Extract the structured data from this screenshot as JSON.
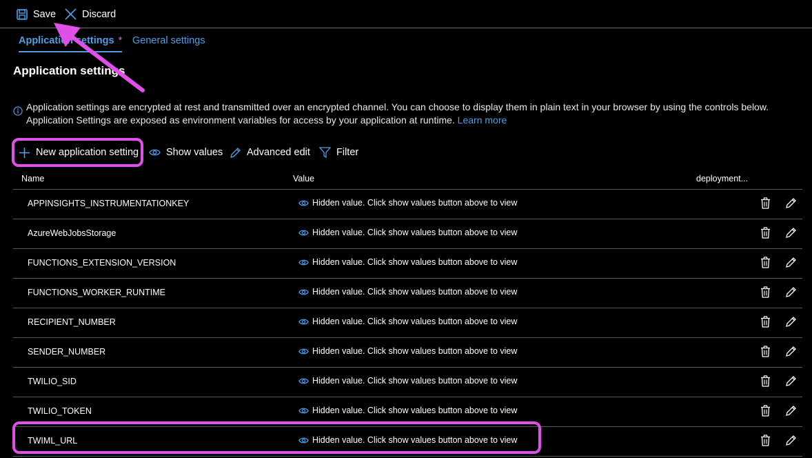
{
  "toolbar": {
    "save_label": "Save",
    "discard_label": "Discard"
  },
  "tabs": [
    {
      "label": "Application settings",
      "modified_marker": "*",
      "active": true
    },
    {
      "label": "General settings",
      "active": false
    }
  ],
  "section": {
    "title": "Application settings",
    "info_text": "Application settings are encrypted at rest and transmitted over an encrypted channel. You can choose to display them in plain text in your browser by using the controls below. Application Settings are exposed as environment variables for access by your application at runtime.",
    "info_link": "Learn more"
  },
  "actions": {
    "new_setting": "New application setting",
    "show_values": "Show values",
    "advanced_edit": "Advanced edit",
    "filter": "Filter"
  },
  "table": {
    "columns": [
      "Name",
      "Value",
      "deployment..."
    ],
    "rows": [
      {
        "name": "APPINSIGHTS_INSTRUMENTATIONKEY",
        "value": "Hidden value. Click show values button above to view"
      },
      {
        "name": "AzureWebJobsStorage",
        "value": "Hidden value. Click show values button above to view"
      },
      {
        "name": "FUNCTIONS_EXTENSION_VERSION",
        "value": "Hidden value. Click show values button above to view"
      },
      {
        "name": "FUNCTIONS_WORKER_RUNTIME",
        "value": "Hidden value. Click show values button above to view"
      },
      {
        "name": "RECIPIENT_NUMBER",
        "value": "Hidden value. Click show values button above to view"
      },
      {
        "name": "SENDER_NUMBER",
        "value": "Hidden value. Click show values button above to view"
      },
      {
        "name": "TWILIO_SID",
        "value": "Hidden value. Click show values button above to view"
      },
      {
        "name": "TWILIO_TOKEN",
        "value": "Hidden value. Click show values button above to view"
      },
      {
        "name": "TWIML_URL",
        "value": "Hidden value. Click show values button above to view"
      }
    ]
  },
  "colors": {
    "accent": "#4f9fe8",
    "highlight": "#e04fe8",
    "background": "#000000"
  },
  "icons": [
    "save-icon",
    "close-icon",
    "plus-icon",
    "eye-icon",
    "pencil-icon",
    "filter-icon",
    "info-icon",
    "trash-icon"
  ]
}
